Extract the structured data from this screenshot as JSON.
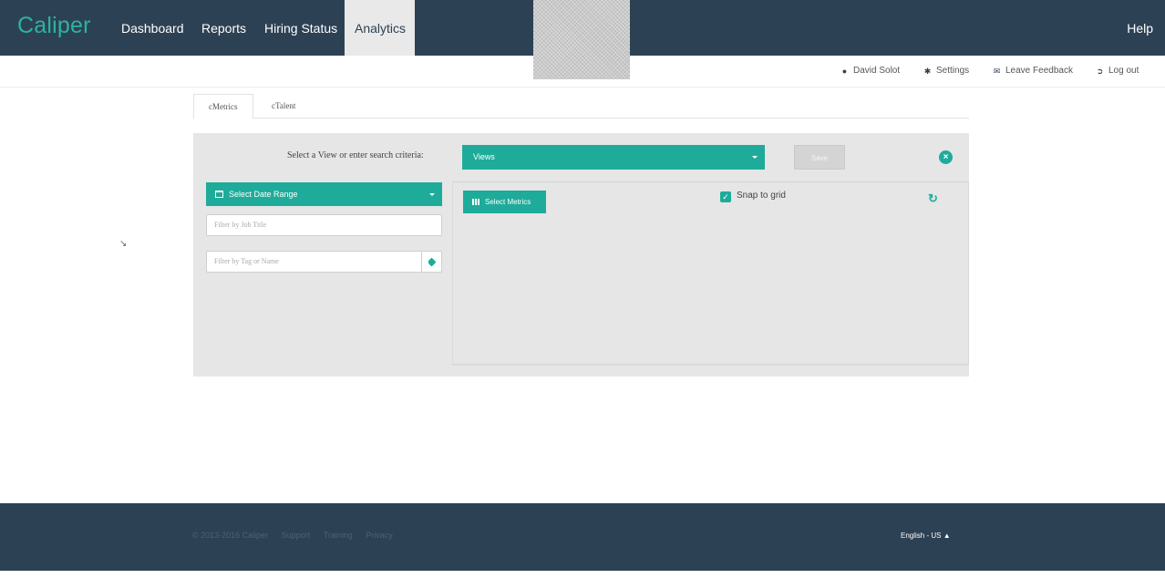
{
  "app": {
    "logo": "Caliper"
  },
  "nav": {
    "items": [
      {
        "label": "Dashboard"
      },
      {
        "label": "Reports"
      },
      {
        "label": "Hiring Status"
      },
      {
        "label": "Analytics",
        "active": true
      }
    ],
    "help": "Help"
  },
  "subnav": {
    "user": "David Solot",
    "settings": "Settings",
    "feedback": "Leave Feedback",
    "logout": "Log out"
  },
  "tabs": [
    {
      "label": "cMetrics",
      "active": true
    },
    {
      "label": "cTalent"
    }
  ],
  "panel": {
    "criteria_label": "Select a View or enter search criteria:",
    "views_select": "Views",
    "save_label": "Save",
    "date_range": "Select Date Range",
    "job_title_placeholder": "Filter by Job Title",
    "tag_placeholder": "Filter by Tag or Name",
    "select_metrics": "Select Metrics",
    "snap_to_grid": "Snap to grid",
    "snap_checked": true
  },
  "footer": {
    "copyright": "© 2013-2016 Caliper",
    "links": [
      "Support",
      "Training",
      "Privacy"
    ],
    "language": "English - US"
  },
  "colors": {
    "nav_bg": "#2d4154",
    "accent": "#1fab9a",
    "logo": "#2bb3a1"
  }
}
